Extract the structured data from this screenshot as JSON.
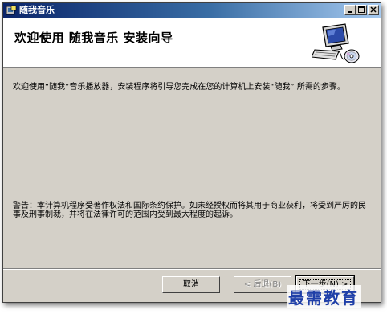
{
  "window": {
    "title": "随我音乐",
    "icon": "installer-icon"
  },
  "header": {
    "heading": "欢迎使用 随我音乐 安装向导",
    "illustration": "computer-cd-icon"
  },
  "content": {
    "intro": "欢迎使用“随我”音乐播放器，安装程序将引导您完成在您的计算机上安装“随我” 所需的步骤。",
    "warning": "警告：本计算机程序受著作权法和国际条约保护。如未经授权而将其用于商业获利，将受到严厉的民事及刑事制裁，并将在法律许可的范围内受到最大程度的起诉。"
  },
  "buttons": {
    "cancel": "取消",
    "back": "< 后退(B)",
    "next": "下一步(N) >"
  },
  "watermark": "最需教育"
}
